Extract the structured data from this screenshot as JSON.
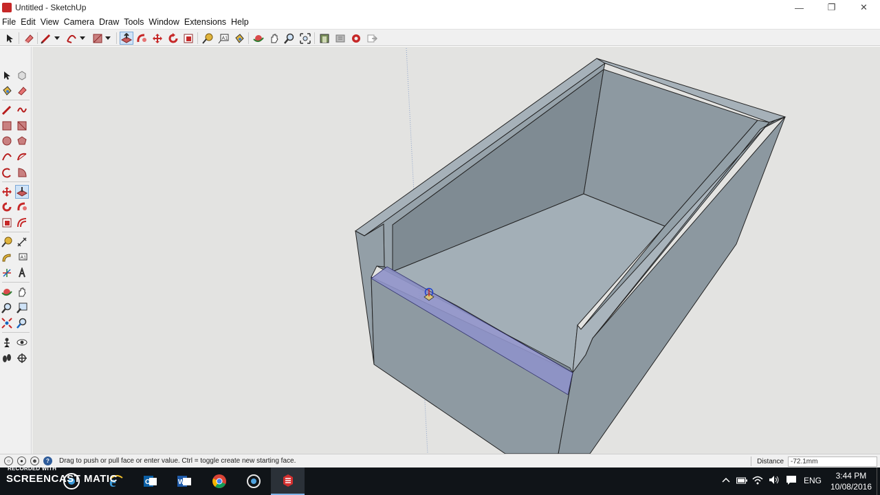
{
  "window": {
    "title": "Untitled - SketchUp",
    "controls": [
      "minimize",
      "restore",
      "close"
    ]
  },
  "menubar": {
    "items": [
      "File",
      "Edit",
      "View",
      "Camera",
      "Draw",
      "Tools",
      "Window",
      "Extensions",
      "Help"
    ]
  },
  "toolbar": {
    "tools": [
      "select",
      "eraser",
      "line",
      "arc",
      "rectangle",
      "push-pull",
      "follow-me",
      "move",
      "rotate",
      "scale",
      "tape-measure",
      "text",
      "paint-bucket",
      "orbit",
      "pan",
      "zoom",
      "zoom-extents",
      "warehouse",
      "extension-warehouse",
      "layout",
      "send-to-layout"
    ],
    "active_tool": "push-pull"
  },
  "left_toolbar": {
    "active_tool": "push-pull"
  },
  "status": {
    "hint": "Drag to push or pull face or enter value.  Ctrl = toggle create new starting face.",
    "measure_label": "Distance",
    "measure_value": "-72.1mm"
  },
  "taskbar": {
    "recorder_top": "RECORDED WITH",
    "recorder_name": "SCREENCAST MATIC",
    "apps": [
      "internet-explorer",
      "outlook",
      "word",
      "chrome",
      "cortana",
      "sketchup"
    ],
    "language": "ENG",
    "time": "3:44 PM",
    "date": "10/08/2016"
  },
  "colors": {
    "viewport_bg": "#e3e3e1",
    "face_front": "#8b98a0",
    "face_inner": "#8b979f",
    "face_top": "#a2aeb6",
    "selection": "#5b63c9"
  }
}
